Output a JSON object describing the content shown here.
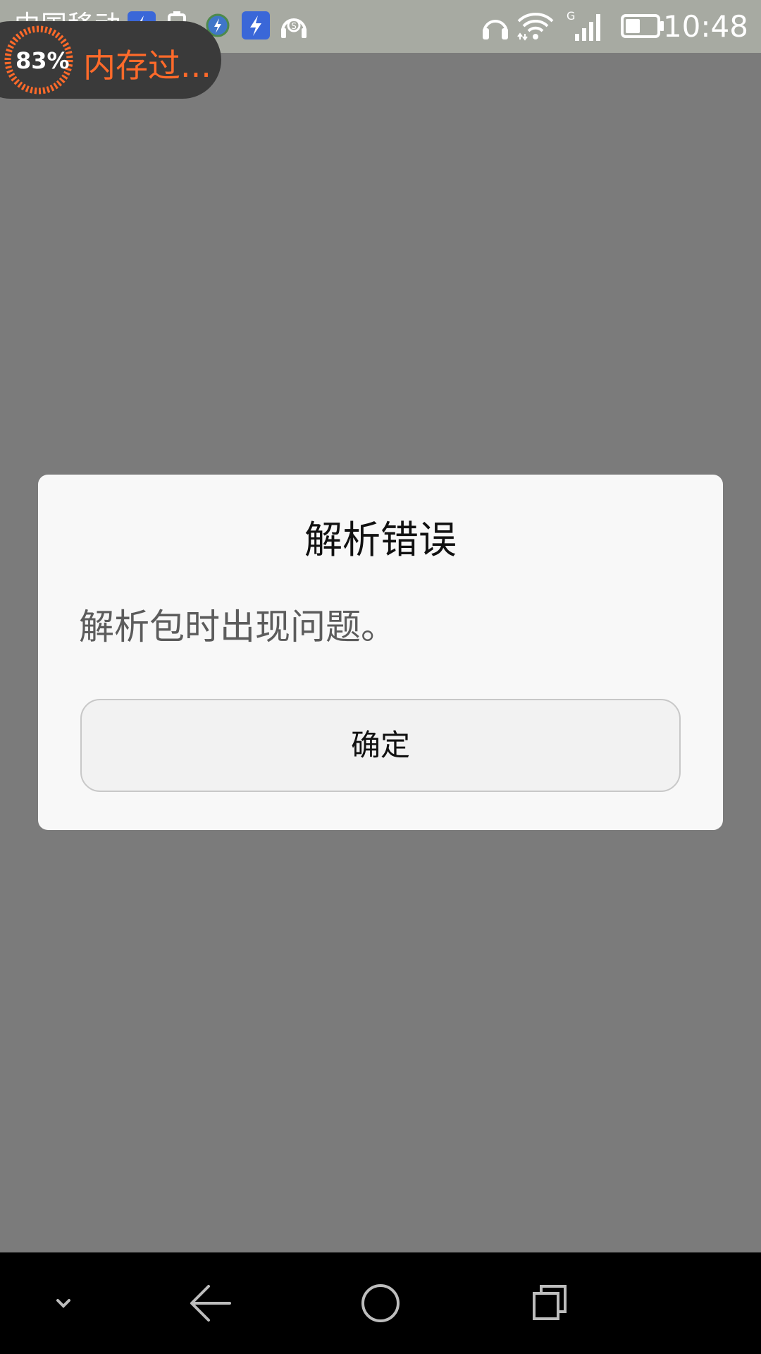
{
  "status_bar": {
    "carrier": "中国移动",
    "network_type": "G",
    "time": "10:48",
    "icons": [
      "flash-app-icon",
      "battery-warning-icon",
      "app-notification-icon",
      "flash-app-icon",
      "headset-s-icon",
      "headphones-icon",
      "wifi-icon",
      "signal-icon",
      "battery-icon"
    ]
  },
  "memory_widget": {
    "percent": "83%",
    "label": "内存过...",
    "accent_color": "#ff6a2a"
  },
  "dialog": {
    "title": "解析错误",
    "message": "解析包时出现问题。",
    "confirm_label": "确定"
  },
  "nav_bar": {
    "buttons": [
      "collapse-icon",
      "back-icon",
      "home-icon",
      "recents-icon"
    ]
  }
}
